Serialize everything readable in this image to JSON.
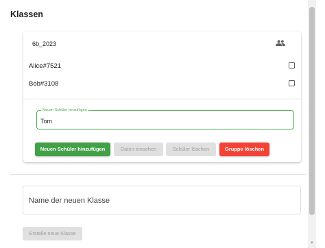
{
  "page": {
    "title": "Klassen"
  },
  "group": {
    "name": "6b_2023",
    "icon": "people-icon",
    "students": [
      {
        "name": "Alice#7521",
        "checked": false
      },
      {
        "name": "Bob#3108",
        "checked": false
      }
    ],
    "new_student": {
      "label": "Neuen Schüler hinzufügen",
      "value": "Tom"
    },
    "buttons": {
      "add_student": "Neuen Schüler hinzufügen",
      "view_data": "Daten einsehen",
      "delete_students": "Schüler löschen",
      "delete_group": "Gruppe löschen"
    }
  },
  "new_class": {
    "placeholder": "Name der neuen Klasse",
    "create_label": "Erstelle neue Klasse"
  },
  "colors": {
    "primary_green": "#43a047",
    "danger_red": "#f44336",
    "disabled_gray": "#e0e0e0"
  }
}
